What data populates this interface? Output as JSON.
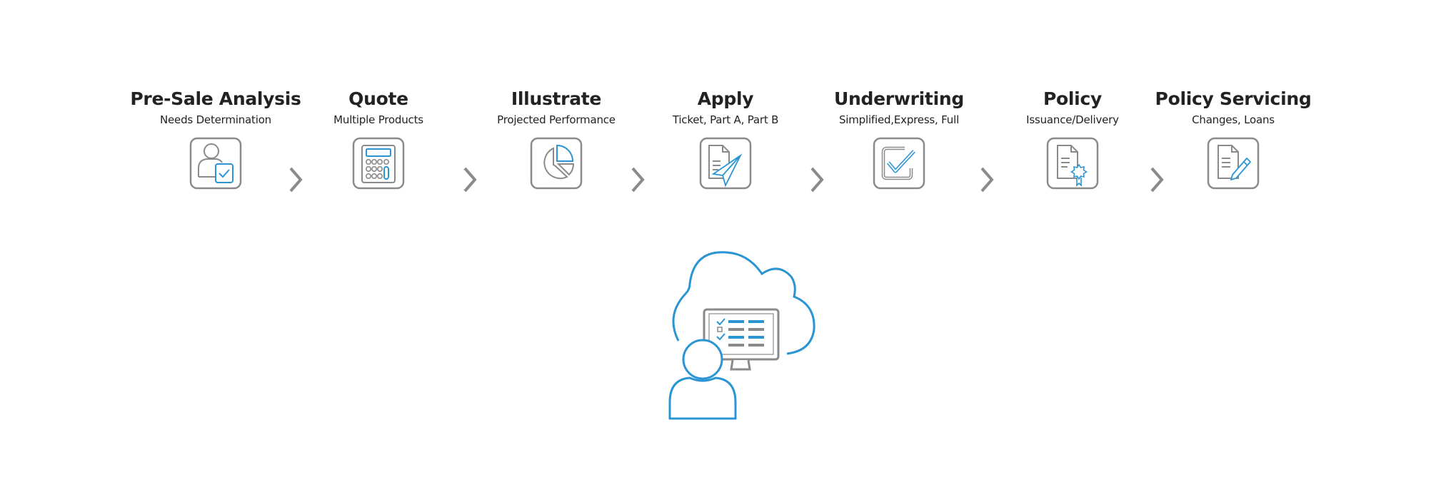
{
  "colors": {
    "accent": "#2b95d3",
    "gray": "#8a8a8a",
    "text": "#222222"
  },
  "steps": [
    {
      "title": "Pre-Sale Analysis",
      "subtitle": "Needs Determination",
      "icon": "user-check-icon"
    },
    {
      "title": "Quote",
      "subtitle": "Multiple Products",
      "icon": "calculator-icon"
    },
    {
      "title": "Illustrate",
      "subtitle": "Projected Performance",
      "icon": "pie-chart-icon"
    },
    {
      "title": "Apply",
      "subtitle": "Ticket, Part A, Part B",
      "icon": "document-send-icon"
    },
    {
      "title": "Underwriting",
      "subtitle": "Simplified,Express, Full",
      "icon": "checkbox-icon"
    },
    {
      "title": "Policy",
      "subtitle": "Issuance/Delivery",
      "icon": "certificate-icon"
    },
    {
      "title": "Policy Servicing",
      "subtitle": "Changes, Loans",
      "icon": "document-edit-icon"
    }
  ],
  "hub": {
    "icon": "cloud-user-monitor-icon"
  }
}
